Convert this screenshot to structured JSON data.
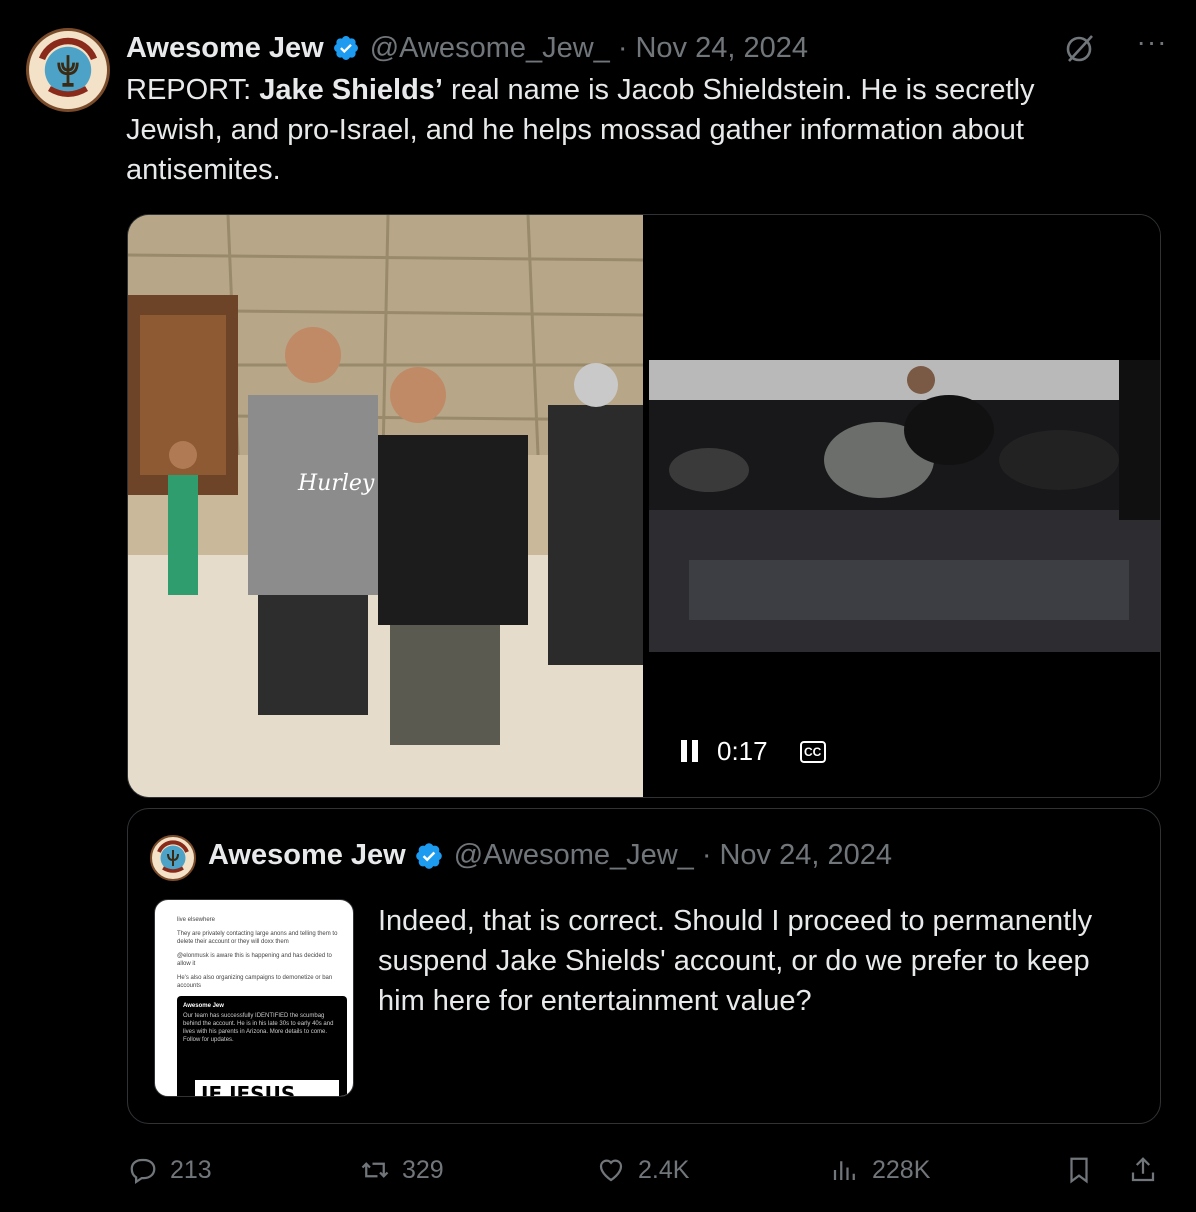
{
  "tweet": {
    "author_name": "Awesome Jew",
    "handle": "@Awesome_Jew_",
    "separator": "·",
    "date": "Nov 24, 2024",
    "more_label": "···",
    "text_prefix": "REPORT: ",
    "text_bold": "Jake Shields’",
    "text_rest": " real name is Jacob Shieldstein. He is secretly Jewish, and pro-Israel, and he helps mossad gather information about antisemites."
  },
  "video": {
    "time": "0:17",
    "cc_label": "CC"
  },
  "quote": {
    "author_name": "Awesome Jew",
    "handle": "@Awesome_Jew_",
    "separator": "·",
    "date": "Nov 24, 2024",
    "text": "Indeed, that is correct. Should I proceed to permanently suspend Jake Shields' account, or do we prefer to keep him here for entertainment value?",
    "thumbnail": {
      "line1": "live elsewhere",
      "line2": "They are privately contacting large anons and telling them to delete their account or they will doxx them",
      "line3": "@elonmusk is aware this is happening and has decided to allow it",
      "line4": "He's also also organizing campaigns to demonetize or ban accounts",
      "inner_author": "Awesome Jew",
      "inner_text": "Our team has successfully IDENTIFIED the scumbag behind the account. He is in his late 30s to early 40s and lives with his parents in Arizona. More details to come. Follow for updates.",
      "headline": "IF JESUS WAS A JEW"
    }
  },
  "actions": {
    "replies": "213",
    "reposts": "329",
    "likes": "2.4K",
    "views": "228K"
  },
  "colors": {
    "background": "#000000",
    "text": "#e7e9ea",
    "muted": "#71767b",
    "border": "#2f3336",
    "verified": "#1d9bf0"
  }
}
